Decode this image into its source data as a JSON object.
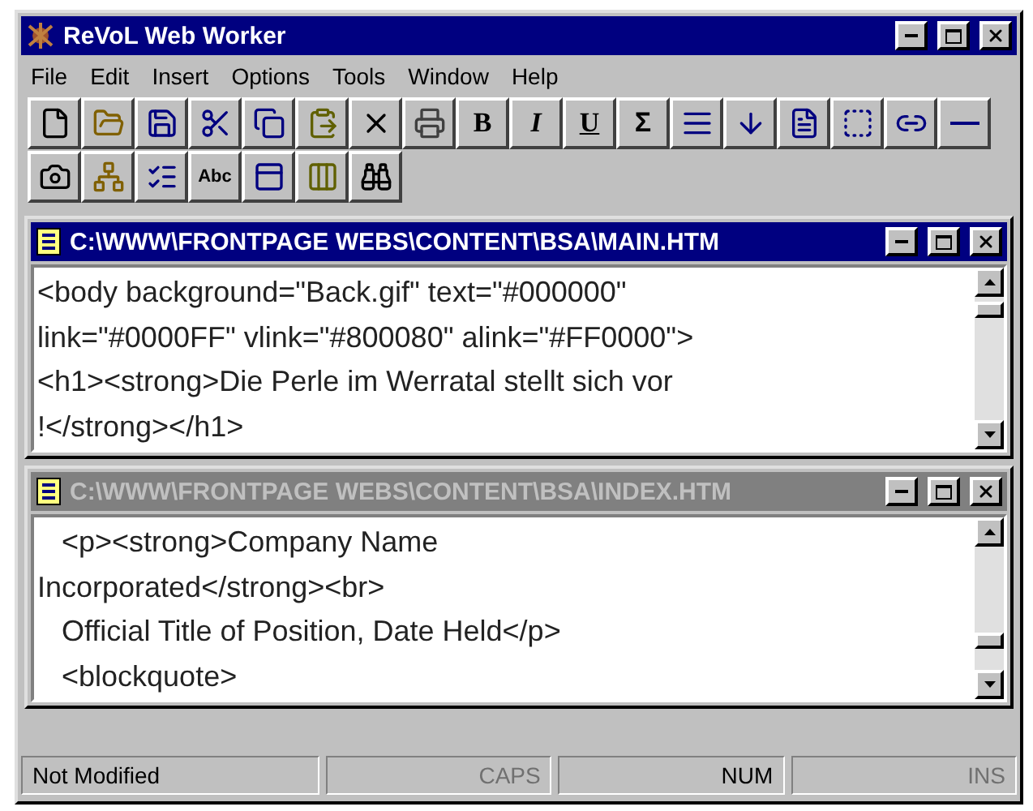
{
  "window": {
    "title": "ReVoL Web Worker"
  },
  "menu": [
    {
      "label": "File"
    },
    {
      "label": "Edit"
    },
    {
      "label": "Insert"
    },
    {
      "label": "Options"
    },
    {
      "label": "Tools"
    },
    {
      "label": "Window"
    },
    {
      "label": "Help"
    }
  ],
  "toolbar_rows": [
    [
      {
        "kind": "icon"
      },
      {
        "kind": "icon"
      },
      {
        "kind": "icon"
      },
      {
        "kind": "icon"
      },
      {
        "kind": "icon"
      },
      {
        "kind": "icon"
      },
      {
        "kind": "icon"
      },
      {
        "kind": "icon"
      },
      {
        "kind": "text",
        "label": "B"
      },
      {
        "kind": "text",
        "label": "I"
      },
      {
        "kind": "text",
        "label": "U"
      },
      {
        "kind": "text",
        "label": "Σ"
      },
      {
        "kind": "icon"
      },
      {
        "kind": "icon"
      },
      {
        "kind": "icon"
      },
      {
        "kind": "icon"
      },
      {
        "kind": "icon"
      },
      {
        "kind": "icon"
      }
    ],
    [
      {
        "kind": "icon"
      },
      {
        "kind": "icon"
      },
      {
        "kind": "icon"
      },
      {
        "kind": "text",
        "label": "Abc"
      },
      {
        "kind": "icon"
      },
      {
        "kind": "icon"
      },
      {
        "kind": "icon"
      }
    ]
  ],
  "documents": [
    {
      "title": "C:\\WWW\\FRONTPAGE WEBS\\CONTENT\\BSA\\MAIN.HTM",
      "active": true,
      "lines": [
        "<body background=\"Back.gif\" text=\"#000000\"",
        "link=\"#0000FF\" vlink=\"#800080\" alink=\"#FF0000\">",
        "<h1><strong>Die Perle im Werratal stellt sich vor",
        "!</strong></h1>"
      ]
    },
    {
      "title": "C:\\WWW\\FRONTPAGE WEBS\\CONTENT\\BSA\\INDEX.HTM",
      "active": false,
      "lines": [
        "   <p><strong>Company Name",
        "Incorporated</strong><br>",
        "   Official Title of Position, Date Held</p>",
        "   <blockquote>"
      ]
    }
  ],
  "status_bar": [
    {
      "text": "Not Modified",
      "on": true
    },
    {
      "text": "CAPS",
      "on": false
    },
    {
      "text": "NUM",
      "on": true
    },
    {
      "text": "INS",
      "on": false
    }
  ]
}
